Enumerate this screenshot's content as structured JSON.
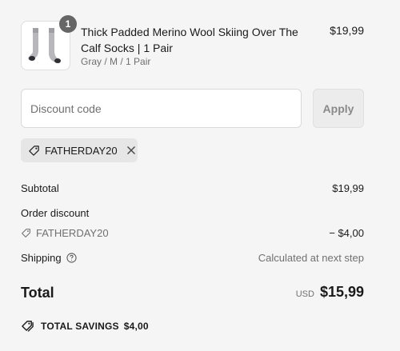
{
  "product": {
    "quantity_badge": "1",
    "title": "Thick Padded Merino Wool Skiing Over The Calf Socks | 1 Pair",
    "variant": "Gray / M / 1 Pair",
    "price": "$19,99",
    "image_icon": "socks-icon"
  },
  "discount": {
    "placeholder": "Discount code",
    "apply_label": "Apply",
    "applied_code": "FATHERDAY20"
  },
  "summary": {
    "subtotal_label": "Subtotal",
    "subtotal_value": "$19,99",
    "order_discount_label": "Order discount",
    "order_discount_code": "FATHERDAY20",
    "order_discount_value": "− $4,00",
    "shipping_label": "Shipping",
    "shipping_value": "Calculated at next step",
    "total_label": "Total",
    "total_currency": "USD",
    "total_value": "$15,99",
    "savings_label": "TOTAL SAVINGS",
    "savings_value": "$4,00"
  },
  "colors": {
    "background": "#f5f5f5",
    "text": "#1a1a1a",
    "muted": "#707070",
    "badge": "#666666"
  }
}
